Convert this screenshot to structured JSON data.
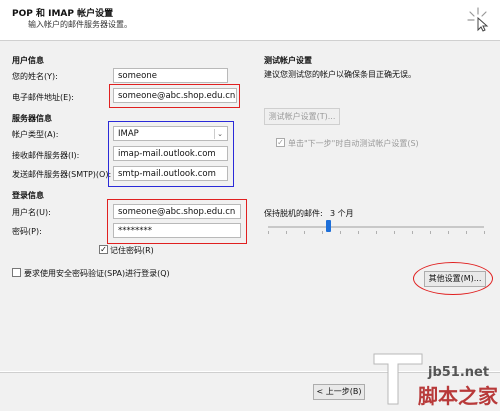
{
  "header": {
    "title": "POP 和 IMAP 帐户设置",
    "subtitle": "输入帐户的邮件服务器设置。"
  },
  "user_info": {
    "section": "用户信息",
    "name_label": "您的姓名(Y):",
    "name_value": "someone",
    "email_label": "电子邮件地址(E):",
    "email_value": "someone@abc.shop.edu.cn"
  },
  "server_info": {
    "section": "服务器信息",
    "account_type_label": "帐户类型(A):",
    "account_type_value": "IMAP",
    "incoming_label": "接收邮件服务器(I):",
    "incoming_value": "imap-mail.outlook.com",
    "outgoing_label": "发送邮件服务器(SMTP)(O):",
    "outgoing_value": "smtp-mail.outlook.com"
  },
  "login_info": {
    "section": "登录信息",
    "username_label": "用户名(U):",
    "username_value": "someone@abc.shop.edu.cn",
    "password_label": "密码(P):",
    "password_value": "********",
    "remember_label": "记住密码(R)",
    "remember_checked": true
  },
  "spa": {
    "label": "要求使用安全密码验证(SPA)进行登录(Q)",
    "checked": false
  },
  "test": {
    "section": "测试帐户设置",
    "description": "建议您测试您的帐户以确保条目正确无误。",
    "button_label": "测试帐户设置(T)...",
    "auto_test_label": "单击\"下一步\"时自动测试帐户设置(S)",
    "auto_test_checked": true
  },
  "offline": {
    "label": "保持脱机的邮件:",
    "value": "3 个月",
    "slider_fraction": 0.28
  },
  "more_settings": {
    "button_label": "其他设置(M)..."
  },
  "footer": {
    "back_label": "< 上一步(B)"
  },
  "watermark": {
    "site": "jb51.net",
    "brand": "脚本之家"
  },
  "colors": {
    "annotation_red": "#e02020",
    "annotation_blue": "#2a2ad8",
    "slider_thumb": "#1e6fd9"
  }
}
